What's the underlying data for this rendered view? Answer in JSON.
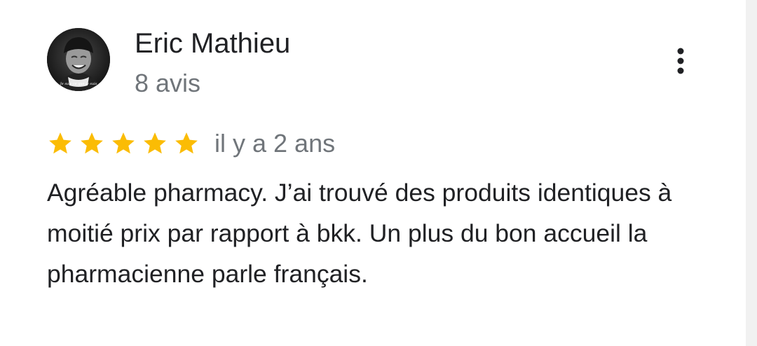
{
  "review": {
    "author": "Eric Mathieu",
    "review_count": "8 avis",
    "rating": 5,
    "rating_max": 5,
    "time_ago": "il y a 2 ans",
    "text": "Agréable pharmacy. J’ai trouvé des produits identiques à moitié prix par rapport à bkk. Un plus du bon accueil la pharmacienne parle français.",
    "avatar_caption": "Je suis ce que je suis"
  },
  "colors": {
    "star": "#fbbc04",
    "name": "#202124",
    "secondary": "#70757a"
  },
  "icons": {
    "more": "more-vert-icon",
    "star": "star-icon"
  }
}
